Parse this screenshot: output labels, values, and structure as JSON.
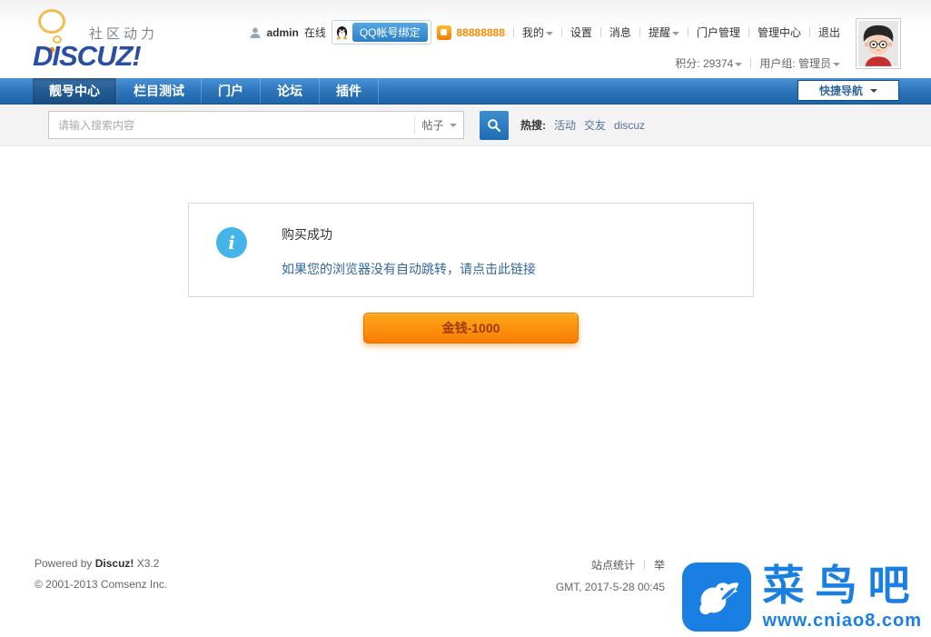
{
  "header": {
    "logo": {
      "brand": "DISCUZ!",
      "tagline": "社区动力"
    },
    "user": {
      "username": "admin",
      "online_label": "在线",
      "qq_bind_label": "QQ帐号绑定",
      "qq_number": "88888888",
      "menu": {
        "mine": "我的",
        "settings": "设置",
        "messages": "消息",
        "reminders": "提醒",
        "portal_admin": "门户管理",
        "admin_center": "管理中心",
        "logout": "退出"
      },
      "credits_label": "积分: 29374",
      "group_label": "用户组: 管理员"
    }
  },
  "nav": {
    "tabs": [
      {
        "label": "靓号中心"
      },
      {
        "label": "栏目测试"
      },
      {
        "label": "门户"
      },
      {
        "label": "论坛"
      },
      {
        "label": "插件"
      }
    ],
    "quick_nav": "快捷导航"
  },
  "search": {
    "placeholder": "请输入搜索内容",
    "scope": "帖子",
    "hot_label": "热搜:",
    "hot_links": [
      "活动",
      "交友",
      "discuz"
    ]
  },
  "main": {
    "message_title": "购买成功",
    "message_link": "如果您的浏览器没有自动跳转，请点击此链接",
    "action_button": "金钱-1000"
  },
  "footer": {
    "powered_prefix": "Powered by",
    "powered_brand": "Discuz!",
    "powered_version": "X3.2",
    "copyright": "© 2001-2013 Comsenz Inc.",
    "stats_link": "站点统计",
    "report_link": "举",
    "gmt": "GMT, 2017-5-28 00:45"
  },
  "watermark": {
    "name": "菜鸟吧",
    "url": "www.cniao8.com"
  },
  "colors": {
    "nav_blue": "#2b73b8",
    "button_orange": "#f87d02",
    "watermark_blue": "#1a7fe3",
    "qq_number_orange": "#ff8a00",
    "link_blue": "#336699",
    "info_icon_blue": "#45b4e8"
  }
}
